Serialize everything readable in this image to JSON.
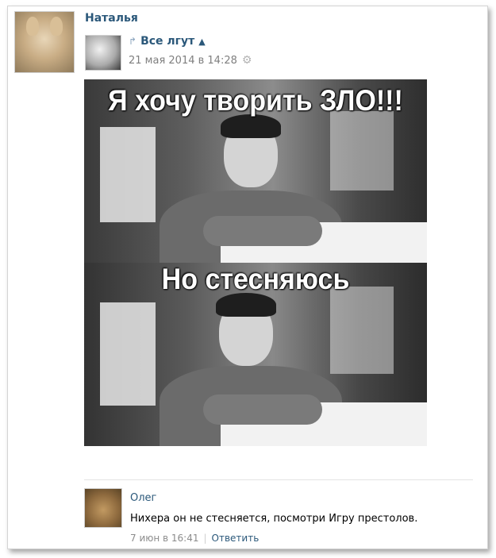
{
  "post": {
    "author": "Наталья",
    "repost": {
      "group_name": "Все лгут",
      "caret": "▲",
      "date": "21 мая 2014 в 14:28"
    },
    "image": {
      "caption_top": "Я хочу творить ЗЛО!!!",
      "caption_bottom": "Но стесняюсь"
    }
  },
  "comment": {
    "author": "Олег",
    "text": "Нихера он не стесняется, посмотри Игру престолов.",
    "date": "7 июн в 16:41",
    "separator": "|",
    "reply_label": "Ответить"
  },
  "icons": {
    "repost": "repost-arrow-icon",
    "settings": "gear-icon"
  },
  "colors": {
    "link": "#2b587a",
    "meta": "#7f7f7f"
  }
}
